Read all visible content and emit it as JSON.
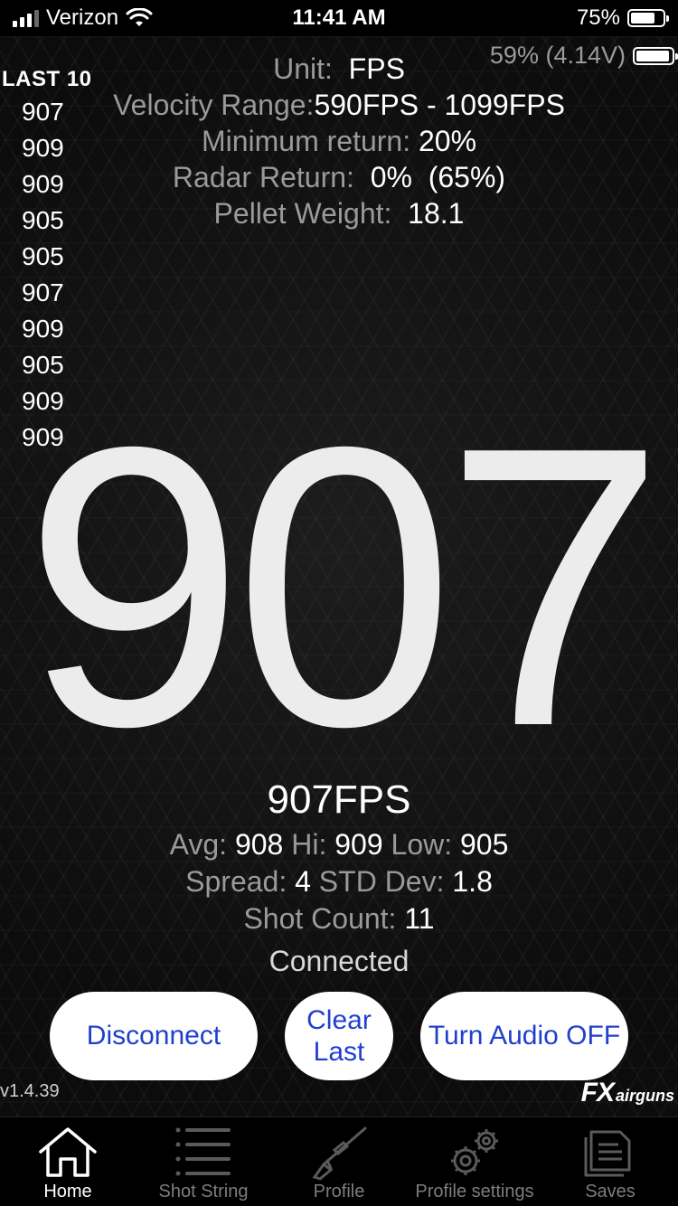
{
  "status_bar": {
    "carrier": "Verizon",
    "time": "11:41 AM",
    "battery": "75%",
    "battery_level": 0.75
  },
  "device_battery": {
    "text": "59% (4.14V)",
    "level": 0.59
  },
  "info": {
    "unit_label": "Unit:",
    "unit_value": "FPS",
    "velocity_label": "Velocity Range:",
    "velocity_value": "590FPS - 1099FPS",
    "min_return_label": "Minimum return:",
    "min_return_value": "20%",
    "radar_label": "Radar Return:",
    "radar_value": "0%",
    "radar_extra": "(65%)",
    "pellet_label": "Pellet Weight:",
    "pellet_value": "18.1"
  },
  "last10": {
    "title": "LAST 10",
    "values": [
      "907",
      "909",
      "909",
      "905",
      "905",
      "907",
      "909",
      "905",
      "909",
      "909"
    ]
  },
  "current": {
    "big": "907",
    "fps": "907FPS"
  },
  "stats": {
    "avg_label": "Avg:",
    "avg": "908",
    "hi_label": "Hi:",
    "hi": "909",
    "low_label": "Low:",
    "low": "905",
    "spread_label": "Spread:",
    "spread": "4",
    "std_label": "STD Dev:",
    "std": "1.8",
    "count_label": "Shot Count:",
    "count": "11"
  },
  "connection": "Connected",
  "buttons": {
    "disconnect": "Disconnect",
    "clear": "Clear Last",
    "audio": "Turn Audio OFF"
  },
  "version": "v1.4.39",
  "logo": {
    "fx": "FX",
    "airguns": "airguns"
  },
  "tabs": [
    {
      "label": "Home",
      "icon": "home-icon",
      "active": true
    },
    {
      "label": "Shot String",
      "icon": "list-icon",
      "active": false
    },
    {
      "label": "Profile",
      "icon": "rifle-icon",
      "active": false
    },
    {
      "label": "Profile settings",
      "icon": "gears-icon",
      "active": false
    },
    {
      "label": "Saves",
      "icon": "folder-icon",
      "active": false
    }
  ]
}
